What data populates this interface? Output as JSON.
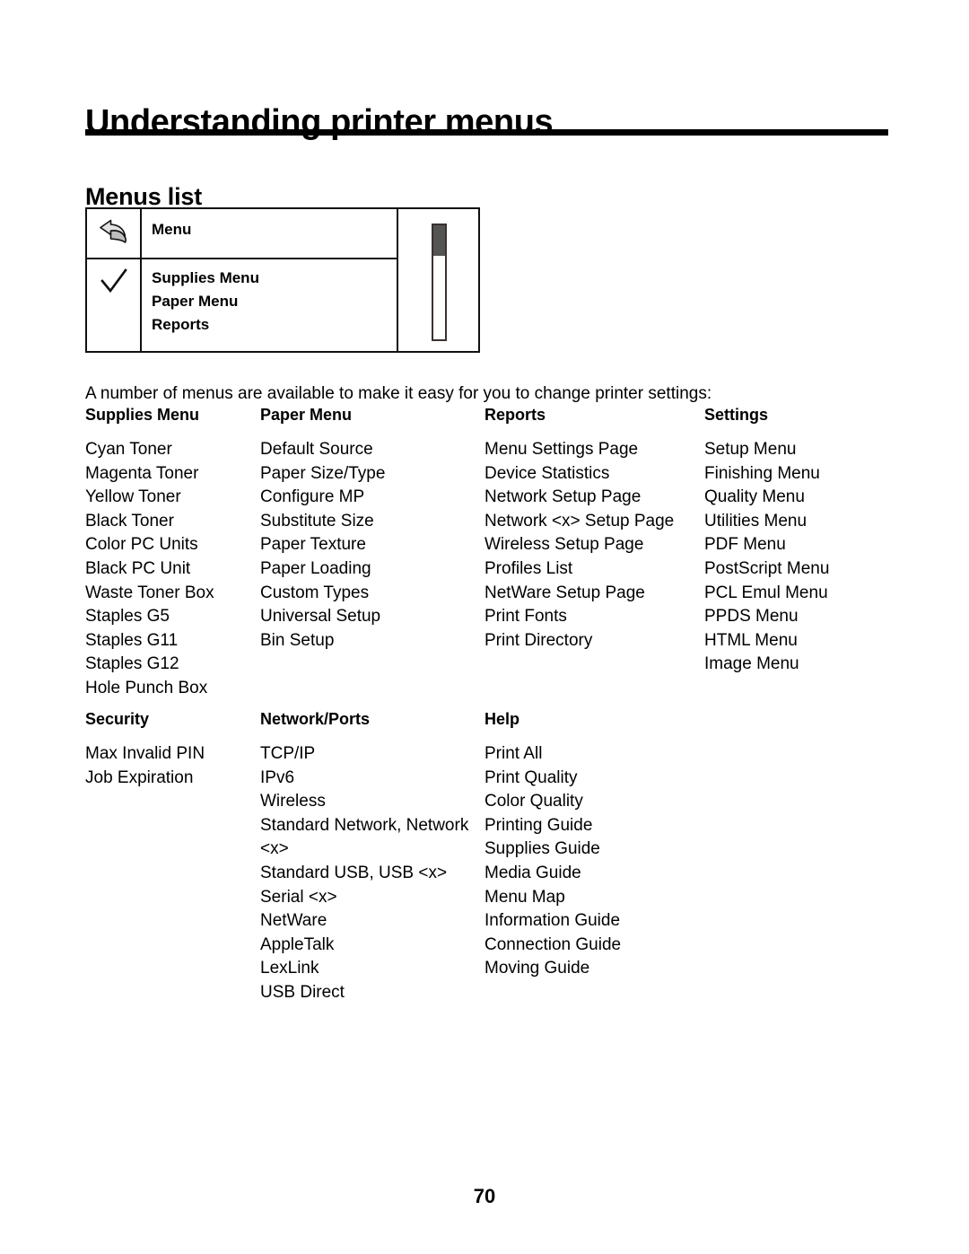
{
  "page": {
    "title": "Understanding printer menus",
    "section_heading": "Menus list",
    "intro": "A number of menus are available to make it easy for you to change printer settings:",
    "page_number": "70"
  },
  "display_panel": {
    "header_label": "Menu",
    "back_icon": "back-arrow-icon",
    "select_icon": "checkmark-icon",
    "items": [
      "Supplies Menu",
      "Paper Menu",
      "Reports"
    ],
    "scrollbar": {
      "thumb_position": "top",
      "thumb_fraction": 0.27,
      "thumb_color": "#545454",
      "track_color": "#ffffff",
      "border_color": "#3a3230"
    }
  },
  "menu_groups": [
    {
      "columns": [
        {
          "heading": "Supplies Menu",
          "items": [
            "Cyan Toner",
            "Magenta Toner",
            "Yellow Toner",
            "Black Toner",
            "Color PC Units",
            "Black PC Unit",
            "Waste Toner Box",
            "Staples G5",
            "Staples G11",
            "Staples G12",
            "Hole Punch Box"
          ]
        },
        {
          "heading": "Paper Menu",
          "items": [
            "Default Source",
            "Paper Size/Type",
            "Configure MP",
            "Substitute Size",
            "Paper Texture",
            "Paper Loading",
            "Custom Types",
            "Universal Setup",
            "Bin Setup"
          ]
        },
        {
          "heading": "Reports",
          "items": [
            "Menu Settings Page",
            "Device Statistics",
            "Network Setup Page",
            "Network <x> Setup Page",
            "Wireless Setup Page",
            "Profiles List",
            "NetWare Setup Page",
            "Print Fonts",
            "Print Directory"
          ]
        },
        {
          "heading": "Settings",
          "items": [
            "Setup Menu",
            "Finishing Menu",
            "Quality Menu",
            "Utilities Menu",
            "PDF Menu",
            "PostScript Menu",
            "PCL Emul Menu",
            "PPDS Menu",
            "HTML Menu",
            "Image Menu"
          ]
        }
      ]
    },
    {
      "columns": [
        {
          "heading": "Security",
          "items": [
            "Max Invalid PIN",
            "Job Expiration"
          ]
        },
        {
          "heading": "Network/Ports",
          "items": [
            "TCP/IP",
            "IPv6",
            "Wireless",
            "Standard Network, Network <x>",
            "Standard USB, USB <x>",
            "Serial <x>",
            "NetWare",
            "AppleTalk",
            "LexLink",
            "USB Direct"
          ]
        },
        {
          "heading": "Help",
          "items": [
            "Print All",
            "Print Quality",
            "Color Quality",
            "Printing Guide",
            "Supplies Guide",
            "Media Guide",
            "Menu Map",
            "Information Guide",
            "Connection Guide",
            "Moving Guide"
          ]
        }
      ]
    }
  ]
}
